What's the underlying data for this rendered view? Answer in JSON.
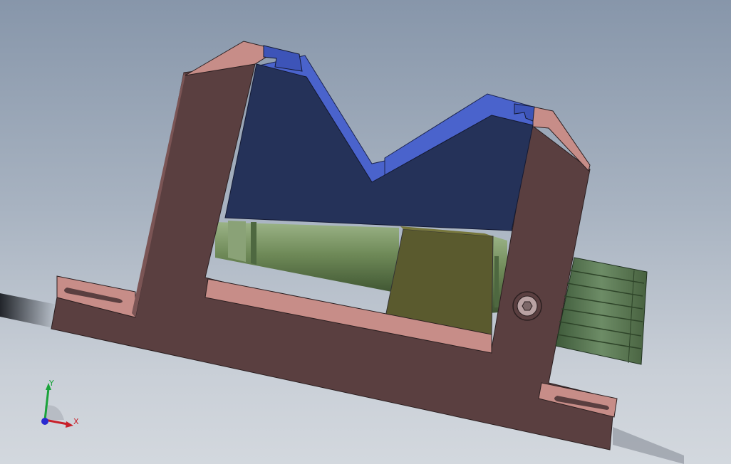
{
  "viewport": {
    "background_top": "#8796aa",
    "background_bottom": "#d3d8de"
  },
  "model": {
    "frame_color": "#5a3f40",
    "frame_face_color": "#c78d88",
    "block_color": "#253259",
    "block_top_color": "#4a63cc",
    "shaft_color": "#6f8a58",
    "nut_color": "#5a5a2e",
    "knob_color": "#5b7a55",
    "bolt_color": "#b9a2a3"
  },
  "triad": {
    "y_label": "Y",
    "x_label": "X",
    "y_color": "#1aa33a",
    "x_color": "#c8202a",
    "z_color": "#2a2ad0"
  }
}
